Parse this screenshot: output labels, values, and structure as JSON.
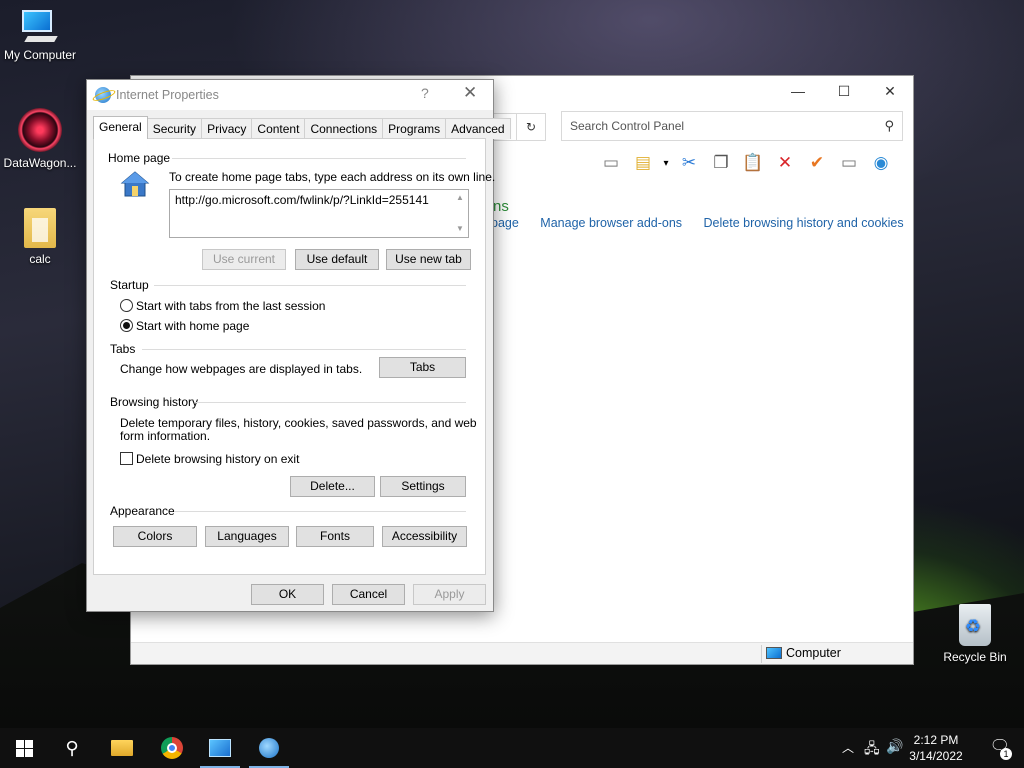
{
  "desktop": {
    "icons": [
      {
        "label": "My Computer"
      },
      {
        "label": "DataWagon..."
      },
      {
        "label": "calc"
      },
      {
        "label": "Recycle Bin"
      }
    ]
  },
  "control_panel": {
    "search_placeholder": "Search Control Panel",
    "heading_partial": "ns",
    "links": [
      "page",
      "Manage browser add-ons",
      "Delete browsing history and cookies"
    ],
    "status_computer": "Computer"
  },
  "dialog": {
    "title": "Internet Properties",
    "help": "?",
    "close": "✕",
    "tabs": [
      "General",
      "Security",
      "Privacy",
      "Content",
      "Connections",
      "Programs",
      "Advanced"
    ],
    "active_tab": "General",
    "home_page": {
      "group": "Home page",
      "instruction": "To create home page tabs, type each address on its own line.",
      "url": "http://go.microsoft.com/fwlink/p/?LinkId=255141",
      "use_current": "Use current",
      "use_default": "Use default",
      "use_new_tab": "Use new tab"
    },
    "startup": {
      "group": "Startup",
      "option_last_session": "Start with tabs from the last session",
      "option_home_page": "Start with home page",
      "selected": "Start with home page"
    },
    "tabs_group": {
      "group": "Tabs",
      "desc": "Change how webpages are displayed in tabs.",
      "button": "Tabs"
    },
    "browsing_history": {
      "group": "Browsing history",
      "desc_line1": "Delete temporary files, history, cookies, saved passwords, and web",
      "desc_line2": "form information.",
      "delete_on_exit": "Delete browsing history on exit",
      "delete_on_exit_checked": false,
      "delete_button": "Delete...",
      "settings_button": "Settings"
    },
    "appearance": {
      "group": "Appearance",
      "colors": "Colors",
      "languages": "Languages",
      "fonts": "Fonts",
      "accessibility": "Accessibility"
    },
    "ok": "OK",
    "cancel": "Cancel",
    "apply": "Apply"
  },
  "taskbar": {
    "time": "2:12 PM",
    "date": "3/14/2022",
    "notification_count": "1"
  }
}
